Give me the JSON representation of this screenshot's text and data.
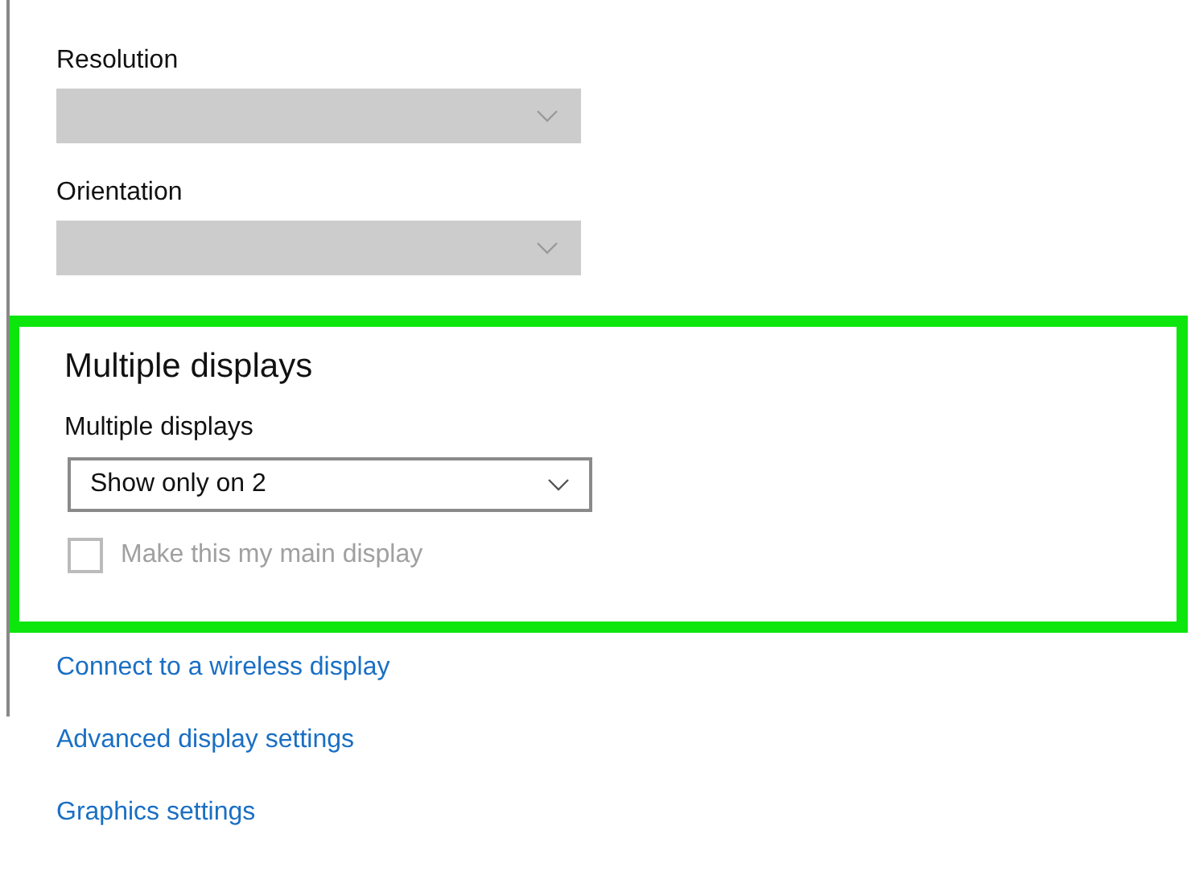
{
  "fields": [
    {
      "label": "Resolution",
      "disabled": true
    },
    {
      "label": "Orientation",
      "disabled": true
    }
  ],
  "multiple_displays": {
    "heading": "Multiple displays",
    "highlighted": true,
    "field": {
      "label": "Multiple displays",
      "value": "Show only on 2",
      "disabled": false
    },
    "checkbox": {
      "label": "Make this my main display",
      "checked": false,
      "disabled": true
    }
  },
  "links": [
    "Connect to a wireless display",
    "Advanced display settings",
    "Graphics settings"
  ]
}
